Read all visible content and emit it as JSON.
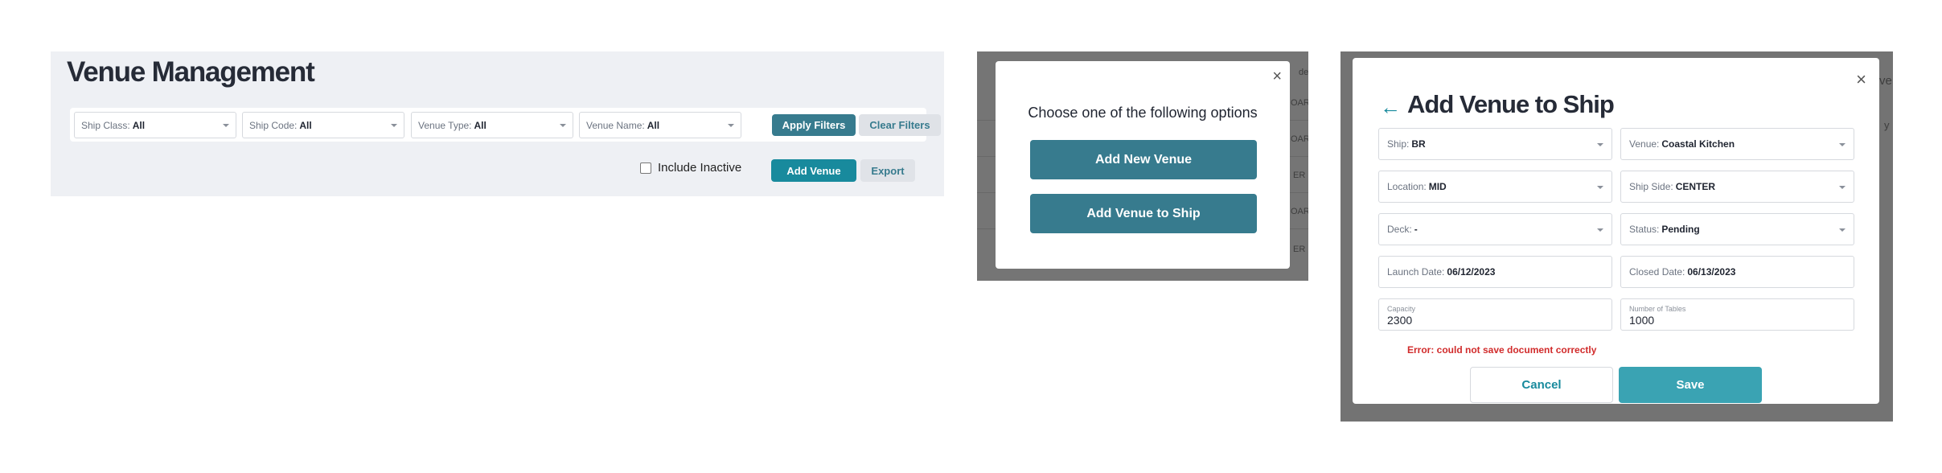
{
  "venue_management": {
    "title": "Venue Management",
    "filters": [
      {
        "label": "Ship Class:",
        "value": "All"
      },
      {
        "label": "Ship Code:",
        "value": "All"
      },
      {
        "label": "Venue Type:",
        "value": "All"
      },
      {
        "label": "Venue Name:",
        "value": "All"
      }
    ],
    "apply_label": "Apply Filters",
    "clear_label": "Clear Filters",
    "include_inactive_label": "Include Inactive",
    "add_venue_label": "Add Venue",
    "export_label": "Export"
  },
  "options_modal": {
    "background_fragments": [
      "de",
      "OAR",
      "OAR",
      "ER",
      "OAR",
      "ER"
    ],
    "close_glyph": "×",
    "heading": "Choose one of the following options",
    "add_new_venue_label": "Add New Venue",
    "add_venue_to_ship_label": "Add Venue to Ship"
  },
  "add_venue_modal": {
    "background_fragments": [
      "ve",
      "y"
    ],
    "back_glyph": "←",
    "close_glyph": "×",
    "title": "Add Venue to Ship",
    "fields": {
      "ship": {
        "label": "Ship:",
        "value": "BR"
      },
      "venue": {
        "label": "Venue:",
        "value": "Coastal Kitchen"
      },
      "location": {
        "label": "Location:",
        "value": "MID"
      },
      "ship_side": {
        "label": "Ship Side:",
        "value": "CENTER"
      },
      "deck": {
        "label": "Deck:",
        "value": "-"
      },
      "status": {
        "label": "Status:",
        "value": "Pending"
      },
      "launch_date": {
        "label": "Launch Date:",
        "value": "06/12/2023"
      },
      "closed_date": {
        "label": "Closed Date:",
        "value": "06/13/2023"
      },
      "capacity": {
        "label": "Capacity",
        "value": "2300"
      },
      "number_of_tables": {
        "label": "Number of Tables",
        "value": "1000"
      }
    },
    "error_text": "Error: could not save document correctly",
    "cancel_label": "Cancel",
    "save_label": "Save"
  }
}
